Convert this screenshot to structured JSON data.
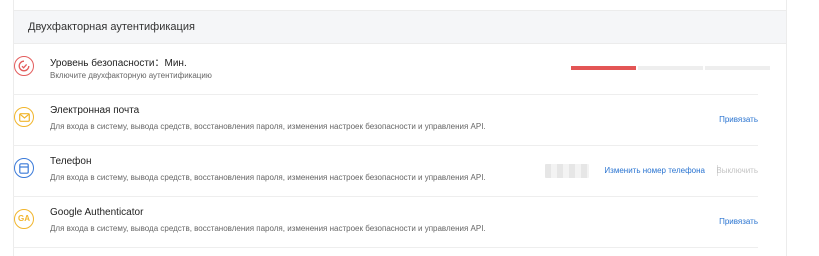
{
  "section": {
    "title": "Двухфакторная аутентификация"
  },
  "security_level": {
    "title": "Уровень безопасности：Мин.",
    "hint": "Включите двухфакторную аутентификацию",
    "meter": {
      "active_segments": 1,
      "total_segments": 3,
      "active_color": "#e35555"
    }
  },
  "email": {
    "title": "Электронная почта",
    "desc": "Для входа в систему, вывода средств, восстановления пароля, изменения настроек безопасности и управления API.",
    "action": "Привязать"
  },
  "phone": {
    "title": "Телефон",
    "desc": "Для входа в систему, вывода средств, восстановления пароля, изменения настроек безопасности и управления API.",
    "change_action": "Изменить номер телефона",
    "disable_action": "Выключить"
  },
  "google_auth": {
    "title": "Google Authenticator",
    "desc": "Для входа в систему, вывода средств, восстановления пароля, изменения настроек безопасности и управления API.",
    "action": "Привязать",
    "icon_text": "GA"
  },
  "colors": {
    "accent_link": "#2a74d1",
    "danger": "#e35d5d",
    "warning": "#f1b52c",
    "info": "#3a7ad9"
  }
}
